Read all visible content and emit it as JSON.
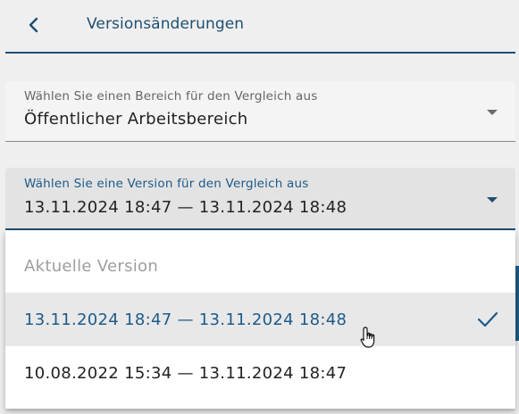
{
  "header": {
    "back_icon": "chevron-left-icon",
    "title": "Versionsänderungen"
  },
  "area_select": {
    "label": "Wählen Sie einen Bereich für den Vergleich aus",
    "value": "Öffentlicher Arbeitsbereich",
    "icon": "dropdown-arrow-icon"
  },
  "version_select": {
    "label": "Wählen Sie eine Version für den Vergleich aus",
    "value": "13.11.2024 18:47 — 13.11.2024 18:48",
    "icon": "dropdown-arrow-icon",
    "state": "open"
  },
  "dropdown": {
    "options": [
      {
        "label": "Aktuelle Version",
        "disabled": true
      },
      {
        "label": "13.11.2024 18:47 — 13.11.2024 18:48",
        "selected": true
      },
      {
        "label": "10.08.2022 15:34 — 13.11.2024 18:47"
      }
    ],
    "selected_icon": "check-icon"
  },
  "colors": {
    "accent": "#1d4f73",
    "selected_text": "#1d5a8a",
    "background": "#efefef"
  }
}
